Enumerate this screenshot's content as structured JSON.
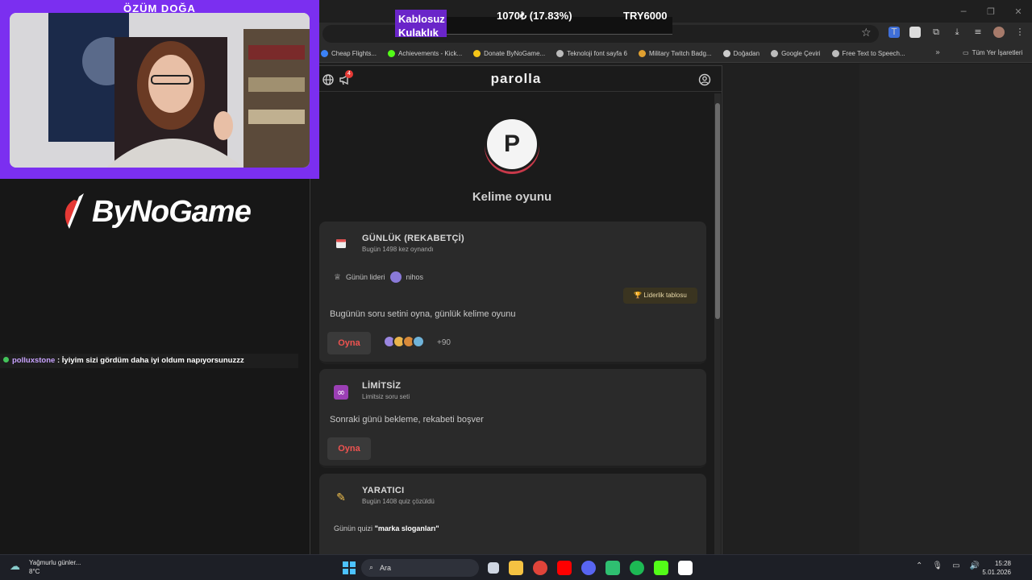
{
  "stream": {
    "cam_name": "ÖZÜM DOĞA",
    "brand": "ByNoGame",
    "ticker": {
      "label": "Kablosuz Kulaklık",
      "percent": "1070₺ (17.83%)",
      "price": "TRY6000"
    },
    "chat": {
      "user": "polluxstone",
      "separator": " : ",
      "message": "İyiyim sizi gördüm daha iyi oldum napıyorsunuzzz"
    }
  },
  "browser": {
    "bookmarks": [
      {
        "label": "Cheap Flights...",
        "color": "#3b82f6"
      },
      {
        "label": "Achievements - Kick...",
        "color": "#53fc18"
      },
      {
        "label": "Donate ByNoGame...",
        "color": "#f5c518"
      },
      {
        "label": "Teknoloji font sayfa 6",
        "color": "#bbbbbb"
      },
      {
        "label": "Military Twitch Badg...",
        "color": "#e0a030"
      },
      {
        "label": "Doğadan",
        "color": "#cccccc"
      },
      {
        "label": "Google Çeviri",
        "color": "#bbbbbb"
      },
      {
        "label": "Free Text to Speech...",
        "color": "#bbbbbb"
      }
    ],
    "bookmarks_more": "»",
    "all_bookmarks": "Tüm Yer İşaretleri"
  },
  "app": {
    "title": "parolla",
    "notif_count": "4",
    "logo_letter": "P",
    "subtitle": "Kelime oyunu",
    "daily": {
      "icon": "calendar-icon",
      "title": "GÜNLÜK (REKABETÇİ)",
      "sub": "Bugün 1498 kez oynandı",
      "leader_label": "Günün lideri",
      "leader_name": "nihos",
      "leaderboard": "🏆 Liderlik tablosu",
      "desc": "Bugünün soru setini oyna, günlük kelime oyunu",
      "play": "Oyna",
      "more": "+90"
    },
    "unlimited": {
      "icon": "infinity-icon",
      "title": "LİMİTSİZ",
      "sub": "Limitsiz soru seti",
      "desc": "Sonraki günü bekleme, rekabeti boşver",
      "play": "Oyna"
    },
    "creator": {
      "icon": "pencil-icon",
      "title": "YARATICI",
      "sub": "Bugün 1408 quiz çözüldü",
      "quiz_label": "Günün quizi",
      "quiz_name": "\"marka sloganları\""
    }
  },
  "taskbar": {
    "weather_title": "Yağmurlu günler...",
    "weather_temp": "8°C",
    "search_label": "Ara",
    "time": "15:28",
    "date": "5.01.2026"
  }
}
